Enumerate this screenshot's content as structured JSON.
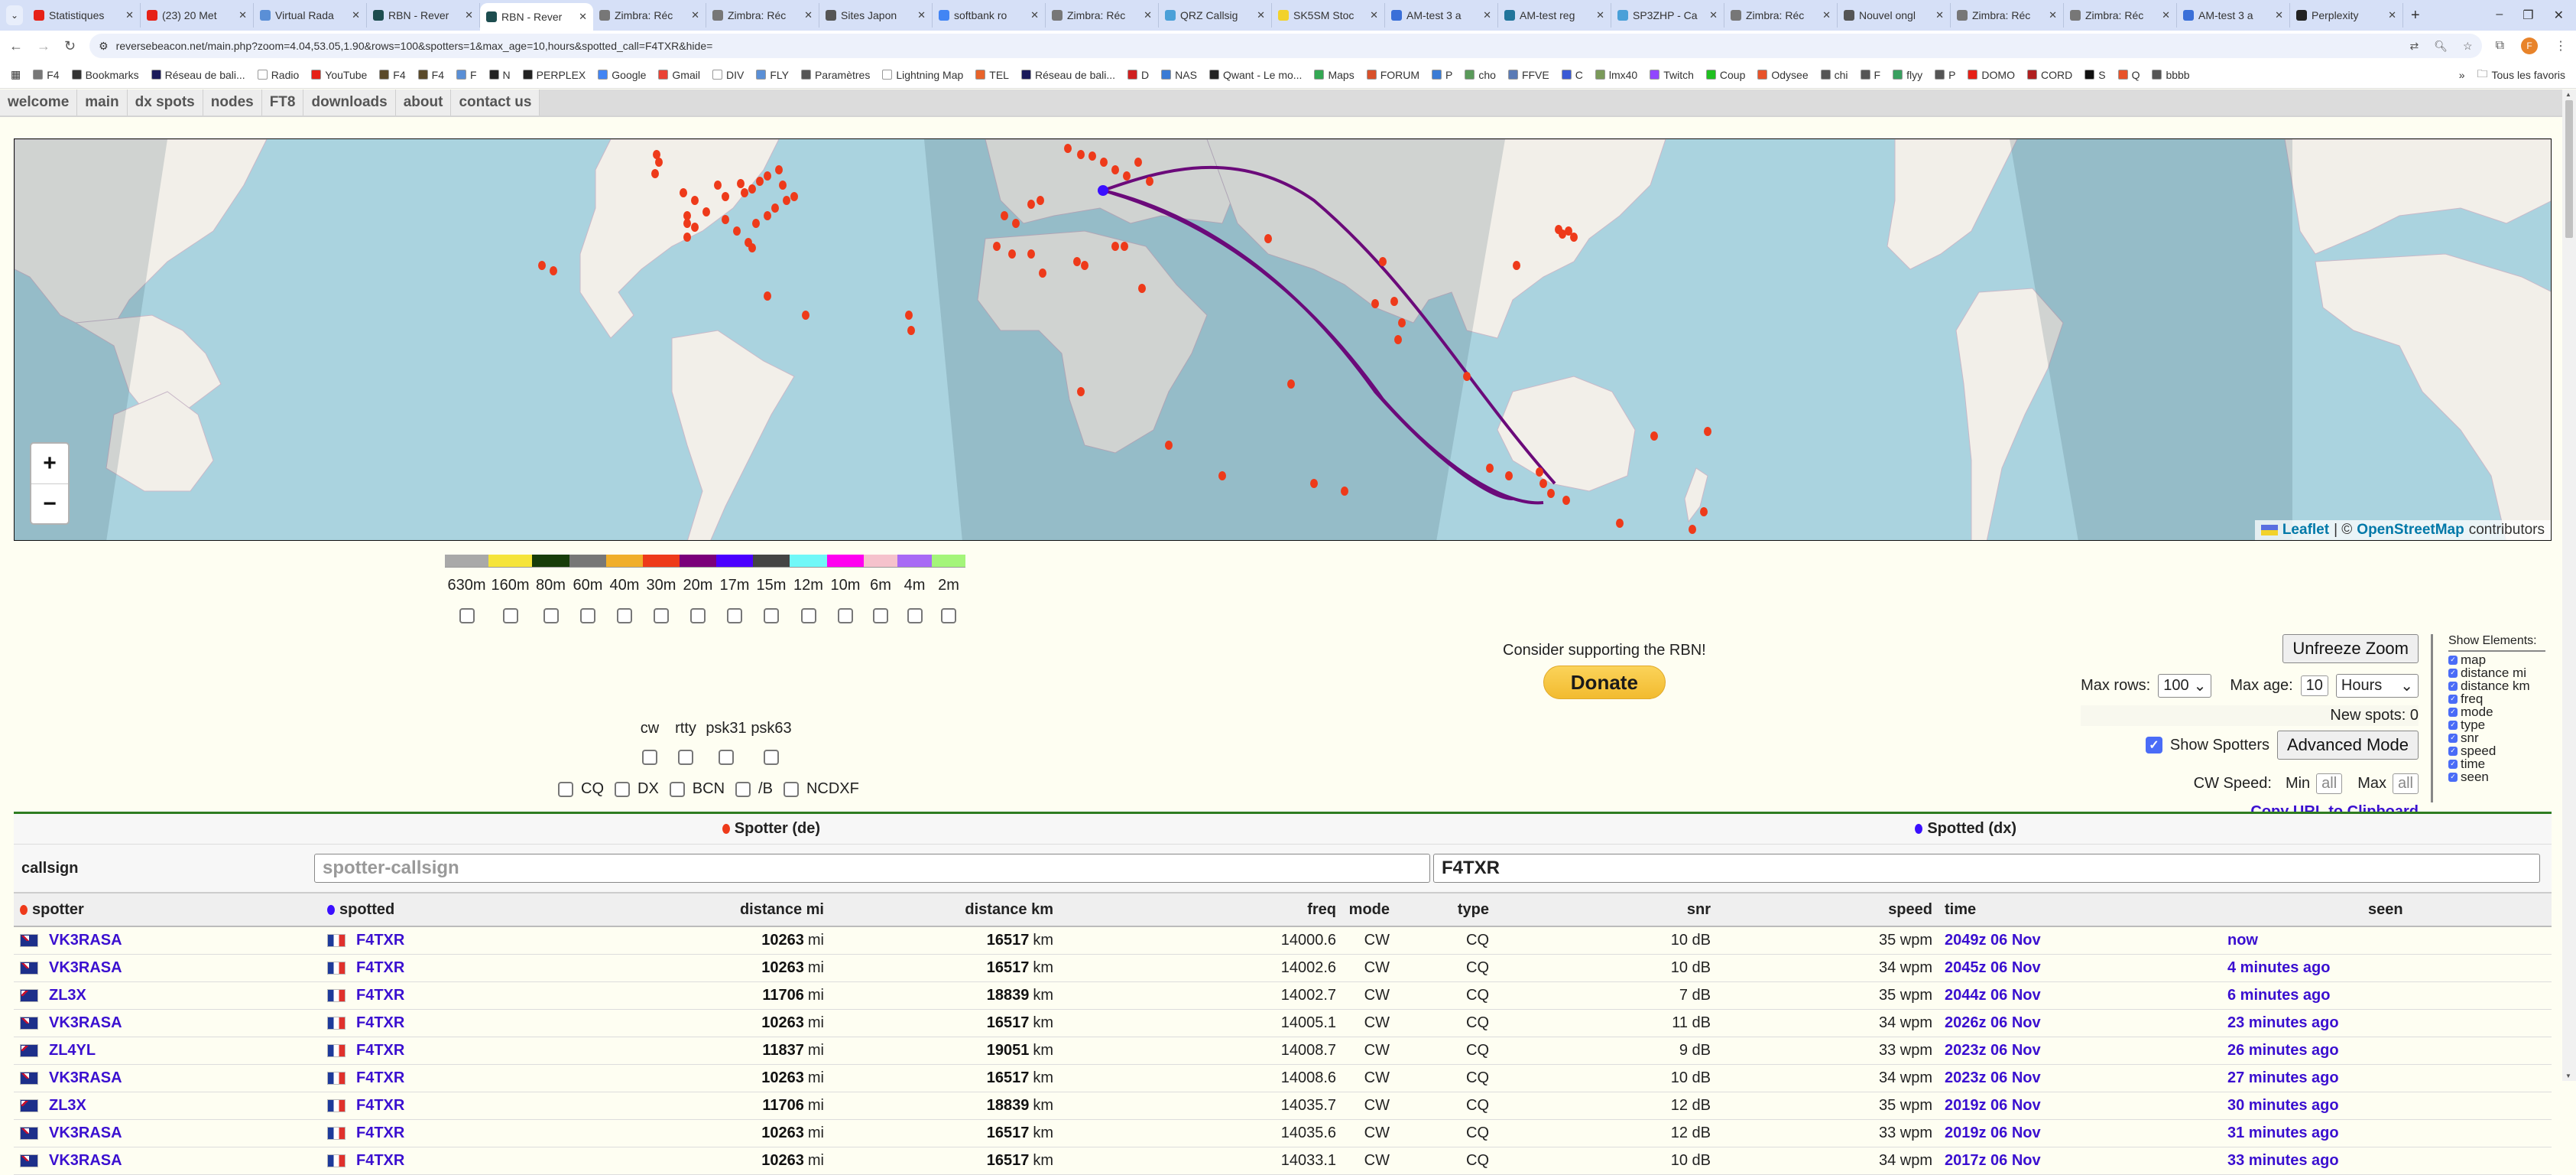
{
  "browser": {
    "tabs": [
      {
        "title": "Statistiques",
        "icon": "youtube-icon",
        "color": "#e62117"
      },
      {
        "title": "(23) 20 Met",
        "icon": "youtube-icon",
        "color": "#e62117"
      },
      {
        "title": "Virtual Rada",
        "icon": "plane-icon",
        "color": "#5a8fd6"
      },
      {
        "title": "RBN - Rever",
        "icon": "rbn-icon",
        "color": "#1d4d4f"
      },
      {
        "title": "RBN - Rever",
        "icon": "rbn-icon",
        "color": "#1d4d4f",
        "active": true
      },
      {
        "title": "Zimbra: Réc",
        "icon": "zimbra-icon",
        "color": "#777777"
      },
      {
        "title": "Zimbra: Réc",
        "icon": "zimbra-icon",
        "color": "#777777"
      },
      {
        "title": "Sites Japon",
        "icon": "globe-icon",
        "color": "#555555"
      },
      {
        "title": "softbank ro",
        "icon": "google-icon",
        "color": "#4285f4"
      },
      {
        "title": "Zimbra: Réc",
        "icon": "zimbra-icon",
        "color": "#777777"
      },
      {
        "title": "QRZ Callsig",
        "icon": "qrz-icon",
        "color": "#4aa0d8"
      },
      {
        "title": "SK5SM Stoc",
        "icon": "smiley-icon",
        "color": "#f2d22b"
      },
      {
        "title": "AM-test 3 a",
        "icon": "drop-icon",
        "color": "#3a6fd8"
      },
      {
        "title": "AM-test reg",
        "icon": "wordpress-icon",
        "color": "#21759b"
      },
      {
        "title": "SP3ZHP - Ca",
        "icon": "qrz-icon",
        "color": "#4aa0d8"
      },
      {
        "title": "Zimbra: Réc",
        "icon": "zimbra-icon",
        "color": "#777777"
      },
      {
        "title": "Nouvel ongl",
        "icon": "globe-icon",
        "color": "#555555"
      },
      {
        "title": "Zimbra: Réc",
        "icon": "zimbra-icon",
        "color": "#777777"
      },
      {
        "title": "Zimbra: Réc",
        "icon": "zimbra-icon",
        "color": "#777777"
      },
      {
        "title": "AM-test 3 a",
        "icon": "drop-icon",
        "color": "#3a6fd8"
      },
      {
        "title": "Perplexity",
        "icon": "perplexity-icon",
        "color": "#222222"
      }
    ],
    "url": "reversebeacon.net/main.php?zoom=4.04,53.05,1.90&rows=100&spotters=1&max_age=10,hours&spotted_call=F4TXR&hide=",
    "profile_initial": "F",
    "bookmarks": [
      {
        "label": "F4",
        "color": "#777777"
      },
      {
        "label": "Bookmarks",
        "color": "#333333"
      },
      {
        "label": "Réseau de bali...",
        "color": "#1a1a5a"
      },
      {
        "label": "Radio",
        "color": "#ffffff"
      },
      {
        "label": "YouTube",
        "color": "#e62117"
      },
      {
        "label": "F4",
        "color": "#5a4a2a"
      },
      {
        "label": "F4",
        "color": "#5a4a2a"
      },
      {
        "label": "F",
        "color": "#5a8fd6"
      },
      {
        "label": "N",
        "color": "#222222"
      },
      {
        "label": "PERPLEX",
        "color": "#222222"
      },
      {
        "label": "Google",
        "color": "#4285f4"
      },
      {
        "label": "Gmail",
        "color": "#ea4335"
      },
      {
        "label": "DIV",
        "color": "#ffffff"
      },
      {
        "label": "FLY",
        "color": "#5a8fd6"
      },
      {
        "label": "Paramètres",
        "color": "#555555"
      },
      {
        "label": "Lightning Map",
        "color": "#ffffff"
      },
      {
        "label": "TEL",
        "color": "#e8632a"
      },
      {
        "label": "Réseau de bali...",
        "color": "#1a1a5a"
      },
      {
        "label": "D",
        "color": "#d02020"
      },
      {
        "label": "NAS",
        "color": "#3a7bd5"
      },
      {
        "label": "Qwant - Le mo...",
        "color": "#222222"
      },
      {
        "label": "Maps",
        "color": "#34a853"
      },
      {
        "label": "FORUM",
        "color": "#d8502a"
      },
      {
        "label": "P",
        "color": "#3a7bd5"
      },
      {
        "label": "cho",
        "color": "#5a9a5a"
      },
      {
        "label": "FFVE",
        "color": "#5a7ab5"
      },
      {
        "label": "C",
        "color": "#3a5ad5"
      },
      {
        "label": "lmx40",
        "color": "#7a9a5a"
      },
      {
        "label": "Twitch",
        "color": "#9146ff"
      },
      {
        "label": "Coup",
        "color": "#20c020"
      },
      {
        "label": "Odysee",
        "color": "#e8532a"
      },
      {
        "label": "chi",
        "color": "#555555"
      },
      {
        "label": "F",
        "color": "#555555"
      },
      {
        "label": "flyy",
        "color": "#3aa060"
      },
      {
        "label": "P",
        "color": "#555555"
      },
      {
        "label": "DOMO",
        "color": "#e62117"
      },
      {
        "label": "CORD",
        "color": "#b02020"
      },
      {
        "label": "S",
        "color": "#111111"
      },
      {
        "label": "Q",
        "color": "#e8532a"
      },
      {
        "label": "bbbb",
        "color": "#555555"
      }
    ],
    "bookmarks_more": "»",
    "all_bookmarks": "Tous les favoris"
  },
  "nav": [
    "welcome",
    "main",
    "dx spots",
    "nodes",
    "FT8",
    "downloads",
    "about",
    "contact us"
  ],
  "map": {
    "zoom_in": "+",
    "zoom_out": "−",
    "attribution": {
      "leaflet": "Leaflet",
      "sep": "| ©",
      "osm": "OpenStreetMap",
      "suffix": "contributors"
    },
    "spotted_color": "#3a0fff",
    "spotter_color": "#ee3a1a",
    "path_color": "#6b0a7a"
  },
  "bands": [
    {
      "label": "630m",
      "color": "#a9a9a9"
    },
    {
      "label": "160m",
      "color": "#f5e43a"
    },
    {
      "label": "80m",
      "color": "#173d0a"
    },
    {
      "label": "60m",
      "color": "#777777"
    },
    {
      "label": "40m",
      "color": "#f0ae2a"
    },
    {
      "label": "30m",
      "color": "#ee3a1a"
    },
    {
      "label": "20m",
      "color": "#7a007a"
    },
    {
      "label": "17m",
      "color": "#4a00ff"
    },
    {
      "label": "15m",
      "color": "#444444"
    },
    {
      "label": "12m",
      "color": "#70f8f8"
    },
    {
      "label": "10m",
      "color": "#ff00f0"
    },
    {
      "label": "6m",
      "color": "#f5c2cc"
    },
    {
      "label": "4m",
      "color": "#a86af5"
    },
    {
      "label": "2m",
      "color": "#a4f57a"
    }
  ],
  "modes": [
    "cw",
    "rtty",
    "psk31",
    "psk63"
  ],
  "spot_types": [
    "CQ",
    "DX",
    "BCN",
    "/B",
    "NCDXF"
  ],
  "support": {
    "text": "Consider supporting the RBN!",
    "donate": "Donate"
  },
  "controls": {
    "unfreeze_zoom": "Unfreeze Zoom",
    "max_rows_label": "Max rows:",
    "max_rows_value": "100",
    "max_age_label": "Max age:",
    "max_age_value": "10",
    "max_age_unit": "Hours",
    "new_spots": "New spots: 0",
    "show_spotters_label": "Show Spotters",
    "show_spotters_checked": true,
    "advanced_mode": "Advanced Mode",
    "cw_speed_label": "CW Speed:",
    "min_label": "Min",
    "min_placeholder": "all",
    "max_label": "Max",
    "max_placeholder": "all",
    "copy_url": "Copy URL to Clipboard"
  },
  "show_elements": {
    "title": "Show Elements:",
    "items": [
      "map",
      "distance mi",
      "distance km",
      "freq",
      "mode",
      "type",
      "snr",
      "speed",
      "time",
      "seen"
    ]
  },
  "table": {
    "spotter_header": "Spotter (de)",
    "spotted_header": "Spotted (dx)",
    "callsign_label": "callsign",
    "spotter_placeholder": "spotter-callsign",
    "spotted_value": "F4TXR",
    "columns": [
      "spotter",
      "spotted",
      "distance mi",
      "distance km",
      "freq",
      "mode",
      "type",
      "snr",
      "speed",
      "time",
      "seen"
    ],
    "rows": [
      {
        "spotter": "VK3RASA",
        "spotter_flag": "au",
        "spotted": "F4TXR",
        "mi": "10263",
        "km": "16517",
        "freq": "14000.6",
        "mode": "CW",
        "type": "CQ",
        "snr": "10 dB",
        "speed": "35 wpm",
        "time": "2049z 06 Nov",
        "seen": "now"
      },
      {
        "spotter": "VK3RASA",
        "spotter_flag": "au",
        "spotted": "F4TXR",
        "mi": "10263",
        "km": "16517",
        "freq": "14002.6",
        "mode": "CW",
        "type": "CQ",
        "snr": "10 dB",
        "speed": "34 wpm",
        "time": "2045z 06 Nov",
        "seen": "4 minutes ago"
      },
      {
        "spotter": "ZL3X",
        "spotter_flag": "nz",
        "spotted": "F4TXR",
        "mi": "11706",
        "km": "18839",
        "freq": "14002.7",
        "mode": "CW",
        "type": "CQ",
        "snr": "7 dB",
        "speed": "35 wpm",
        "time": "2044z 06 Nov",
        "seen": "6 minutes ago"
      },
      {
        "spotter": "VK3RASA",
        "spotter_flag": "au",
        "spotted": "F4TXR",
        "mi": "10263",
        "km": "16517",
        "freq": "14005.1",
        "mode": "CW",
        "type": "CQ",
        "snr": "11 dB",
        "speed": "34 wpm",
        "time": "2026z 06 Nov",
        "seen": "23 minutes ago"
      },
      {
        "spotter": "ZL4YL",
        "spotter_flag": "nz",
        "spotted": "F4TXR",
        "mi": "11837",
        "km": "19051",
        "freq": "14008.7",
        "mode": "CW",
        "type": "CQ",
        "snr": "9 dB",
        "speed": "33 wpm",
        "time": "2023z 06 Nov",
        "seen": "26 minutes ago"
      },
      {
        "spotter": "VK3RASA",
        "spotter_flag": "au",
        "spotted": "F4TXR",
        "mi": "10263",
        "km": "16517",
        "freq": "14008.6",
        "mode": "CW",
        "type": "CQ",
        "snr": "10 dB",
        "speed": "34 wpm",
        "time": "2023z 06 Nov",
        "seen": "27 minutes ago"
      },
      {
        "spotter": "ZL3X",
        "spotter_flag": "nz",
        "spotted": "F4TXR",
        "mi": "11706",
        "km": "18839",
        "freq": "14035.7",
        "mode": "CW",
        "type": "CQ",
        "snr": "12 dB",
        "speed": "35 wpm",
        "time": "2019z 06 Nov",
        "seen": "30 minutes ago"
      },
      {
        "spotter": "VK3RASA",
        "spotter_flag": "au",
        "spotted": "F4TXR",
        "mi": "10263",
        "km": "16517",
        "freq": "14035.6",
        "mode": "CW",
        "type": "CQ",
        "snr": "12 dB",
        "speed": "33 wpm",
        "time": "2019z 06 Nov",
        "seen": "31 minutes ago"
      },
      {
        "spotter": "VK3RASA",
        "spotter_flag": "au",
        "spotted": "F4TXR",
        "mi": "10263",
        "km": "16517",
        "freq": "14033.1",
        "mode": "CW",
        "type": "CQ",
        "snr": "10 dB",
        "speed": "34 wpm",
        "time": "2017z 06 Nov",
        "seen": "33 minutes ago"
      }
    ],
    "unit_mi": "mi",
    "unit_km": "km"
  }
}
